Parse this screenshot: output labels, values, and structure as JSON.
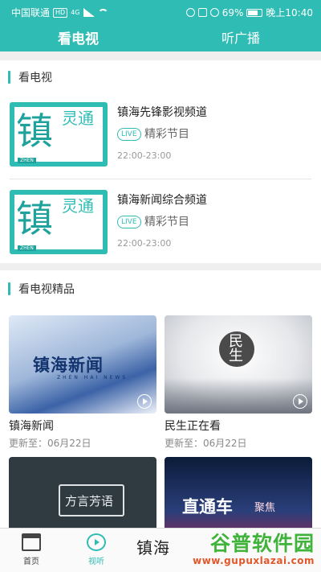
{
  "status_bar": {
    "carrier": "中国联通",
    "badge_hd": "HD",
    "net": "4G",
    "battery": "69%",
    "time": "晚上10:40"
  },
  "tabs": [
    {
      "label": "看电视",
      "active": true
    },
    {
      "label": "听广播",
      "active": false
    }
  ],
  "tv_section": {
    "title": "看电视",
    "channels": [
      {
        "name": "镇海先锋影视频道",
        "live": "LIVE",
        "program": "精彩节目",
        "time": "22:00-23:00",
        "thumb_big": "镇",
        "thumb_small": "灵通",
        "thumb_tag": "ZHEN"
      },
      {
        "name": "镇海新闻综合频道",
        "live": "LIVE",
        "program": "精彩节目",
        "time": "22:00-23:00",
        "thumb_big": "镇",
        "thumb_small": "灵通",
        "thumb_tag": "ZHEN"
      }
    ]
  },
  "featured_section": {
    "title": "看电视精品",
    "items": [
      {
        "title": "镇海新闻",
        "update": "更新至：06月22日",
        "image_text": "镇海新闻",
        "image_sub": "ZHEN HAI NEWS"
      },
      {
        "title": "民生正在看",
        "update": "更新至：06月22日",
        "image_text": "民生"
      },
      {
        "title": "",
        "update": "",
        "image_text": "方言芳语"
      },
      {
        "title": "",
        "update": "",
        "image_text": "直通车",
        "image_text2": "聚焦"
      }
    ]
  },
  "bottom_nav": {
    "items": [
      {
        "label": "首页",
        "icon": "home-icon"
      },
      {
        "label": "视听",
        "icon": "video-icon",
        "active": true
      }
    ],
    "brand": "镇海"
  },
  "watermark": {
    "title": "谷普软件园",
    "url": "www.gupuxlazai.com"
  },
  "colors": {
    "accent": "#2fbcb4",
    "page_bg": "#efefef"
  }
}
